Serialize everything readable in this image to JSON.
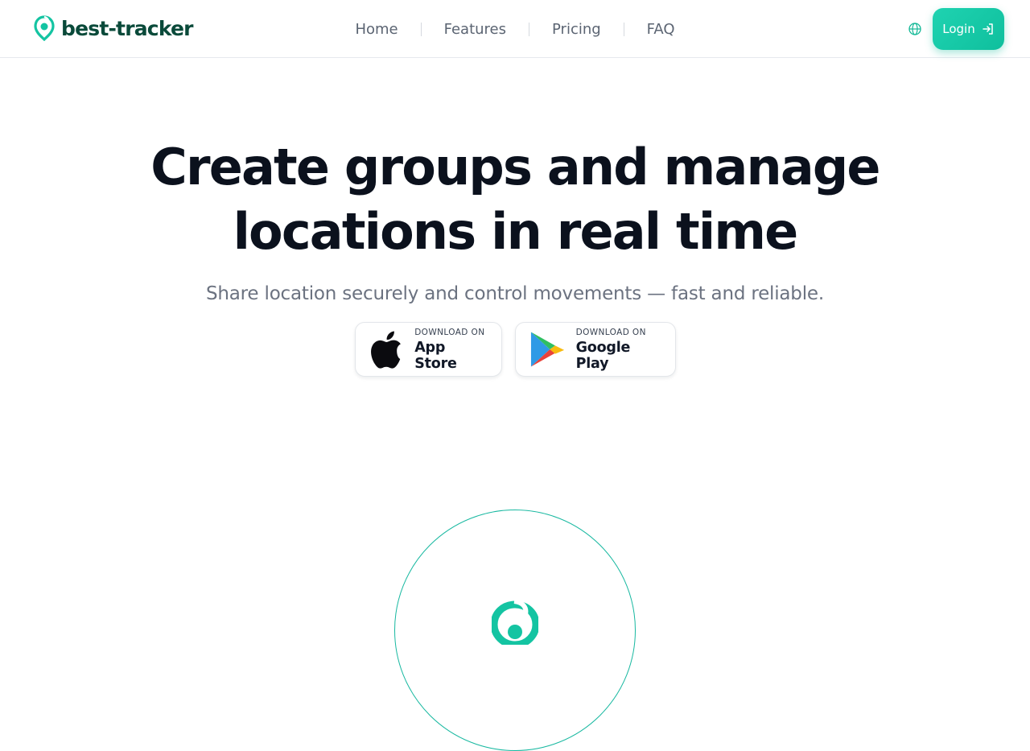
{
  "header": {
    "brand_name": "best-tracker",
    "nav": [
      {
        "label": "Home"
      },
      {
        "label": "Features"
      },
      {
        "label": "Pricing"
      },
      {
        "label": "FAQ"
      }
    ],
    "language_icon": "globe-icon",
    "login_label": "Login",
    "login_icon": "login-arrow-icon"
  },
  "hero": {
    "title": "Create groups and manage locations in real time",
    "subtitle": "Share location securely and control movements — fast and reliable.",
    "store_buttons": [
      {
        "small": "DOWNLOAD ON",
        "big": "App Store",
        "icon": "apple-icon"
      },
      {
        "small": "DOWNLOAD ON",
        "big": "Google Play",
        "icon": "google-play-icon"
      }
    ]
  },
  "colors": {
    "brand": "#0fbf9d",
    "brand_dark": "#0a4a3a",
    "heading": "#0b111d",
    "muted": "#6b7280"
  }
}
